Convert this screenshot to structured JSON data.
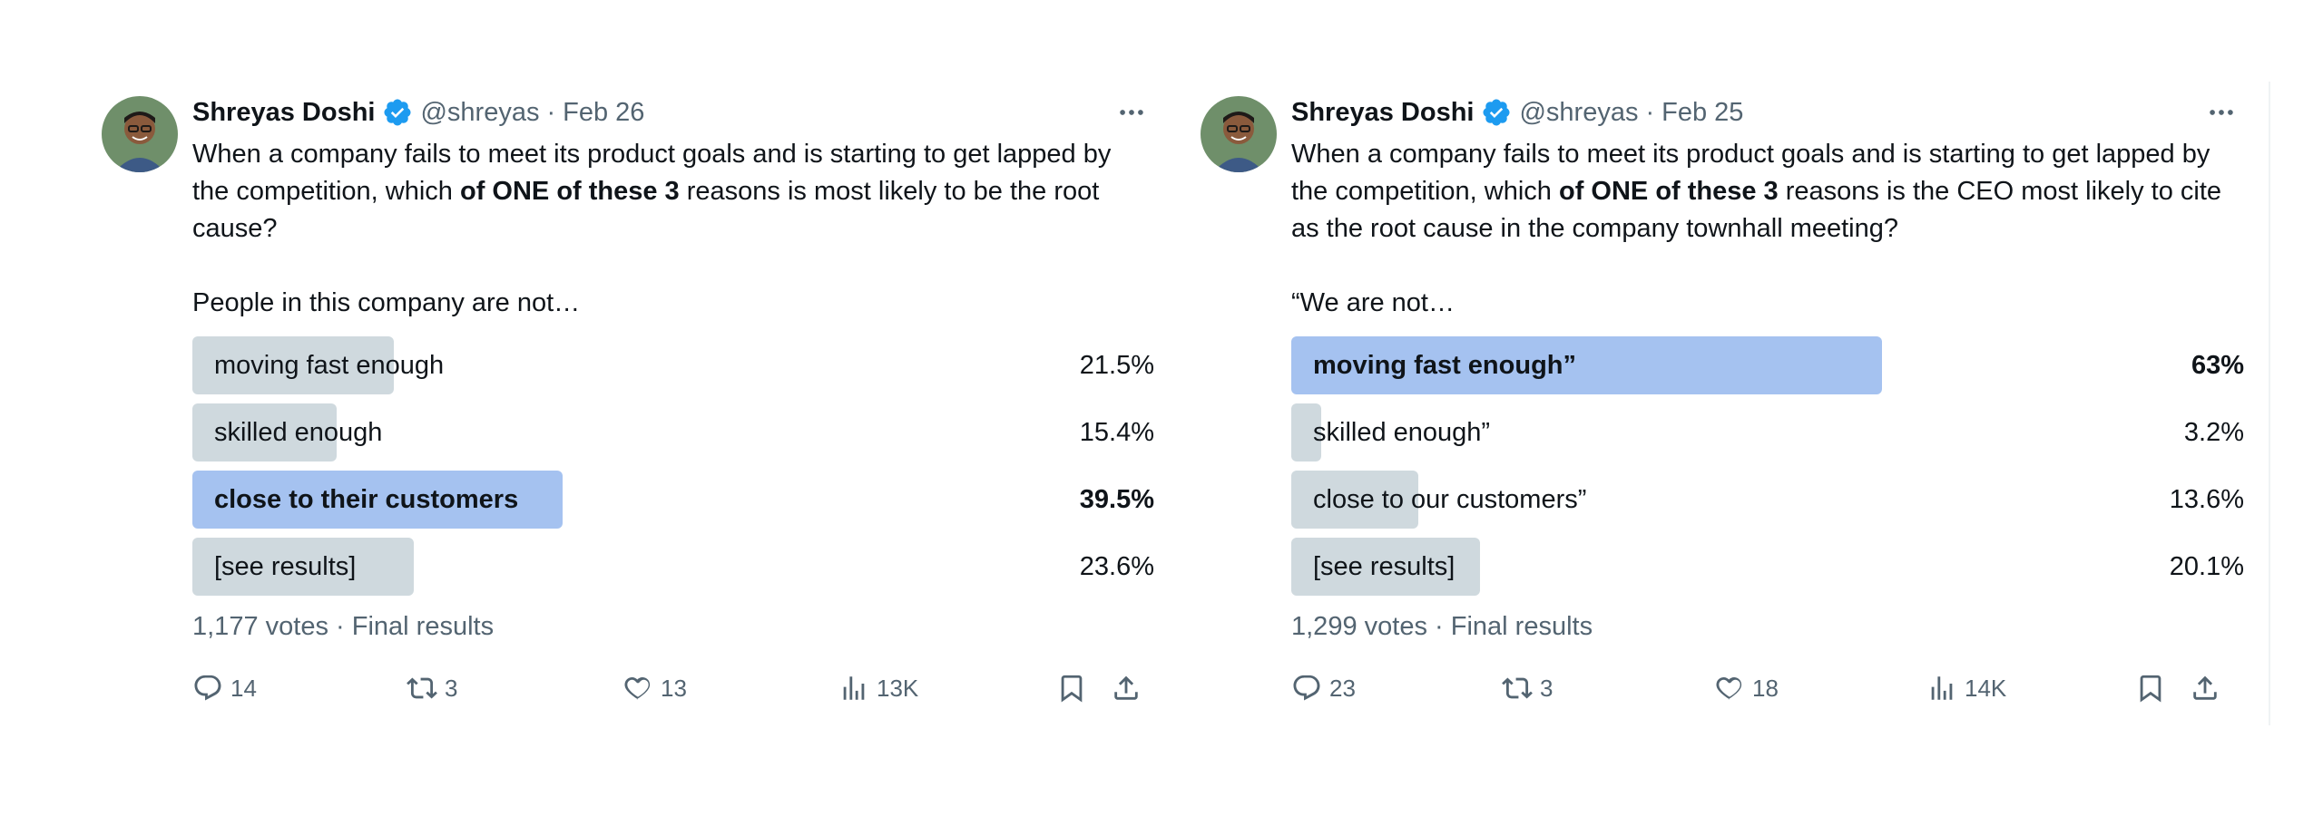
{
  "tweets": [
    {
      "author": {
        "name": "Shreyas Doshi",
        "handle": "@shreyas",
        "date": "Feb 26",
        "verified": true
      },
      "text": {
        "part1": "When a company fails to meet its product goals and is starting to get lapped by the competition, which ",
        "bold": "of ONE of these 3",
        "part2": " reasons is most likely to be the root cause?",
        "lead": "People in this company are not…"
      },
      "poll": {
        "options": [
          {
            "label": "moving fast enough",
            "percent_text": "21.5%",
            "percent": 21.5,
            "winner": false
          },
          {
            "label": "skilled enough",
            "percent_text": "15.4%",
            "percent": 15.4,
            "winner": false
          },
          {
            "label": "close to their customers",
            "percent_text": "39.5%",
            "percent": 39.5,
            "winner": true
          },
          {
            "label": "[see results]",
            "percent_text": "23.6%",
            "percent": 23.6,
            "winner": false
          }
        ],
        "votes": "1,177 votes",
        "status": "Final results"
      },
      "actions": {
        "replies": "14",
        "reposts": "3",
        "likes": "13",
        "views": "13K"
      }
    },
    {
      "author": {
        "name": "Shreyas Doshi",
        "handle": "@shreyas",
        "date": "Feb 25",
        "verified": true
      },
      "text": {
        "part1": "When a company fails to meet its product goals and is starting to get lapped by the competition, which ",
        "bold": "of ONE of these 3",
        "part2": " reasons is the CEO most likely to cite as the root cause in the company townhall meeting?",
        "lead": "“We are not…"
      },
      "poll": {
        "options": [
          {
            "label": "moving fast enough”",
            "percent_text": "63%",
            "percent": 63,
            "winner": true
          },
          {
            "label": "skilled enough”",
            "percent_text": "3.2%",
            "percent": 3.2,
            "winner": false
          },
          {
            "label": "close to our customers”",
            "percent_text": "13.6%",
            "percent": 13.6,
            "winner": false
          },
          {
            "label": "[see results]",
            "percent_text": "20.1%",
            "percent": 20.1,
            "winner": false
          }
        ],
        "votes": "1,299 votes",
        "status": "Final results"
      },
      "actions": {
        "replies": "23",
        "reposts": "3",
        "likes": "18",
        "views": "14K"
      }
    }
  ],
  "colors": {
    "accent": "#1d9bf0",
    "poll_winner": "#a5c2f0",
    "poll_other": "#cfd9de",
    "muted_text": "#536471",
    "primary_text": "#0f1419"
  },
  "separators": {
    "dot": "·"
  }
}
